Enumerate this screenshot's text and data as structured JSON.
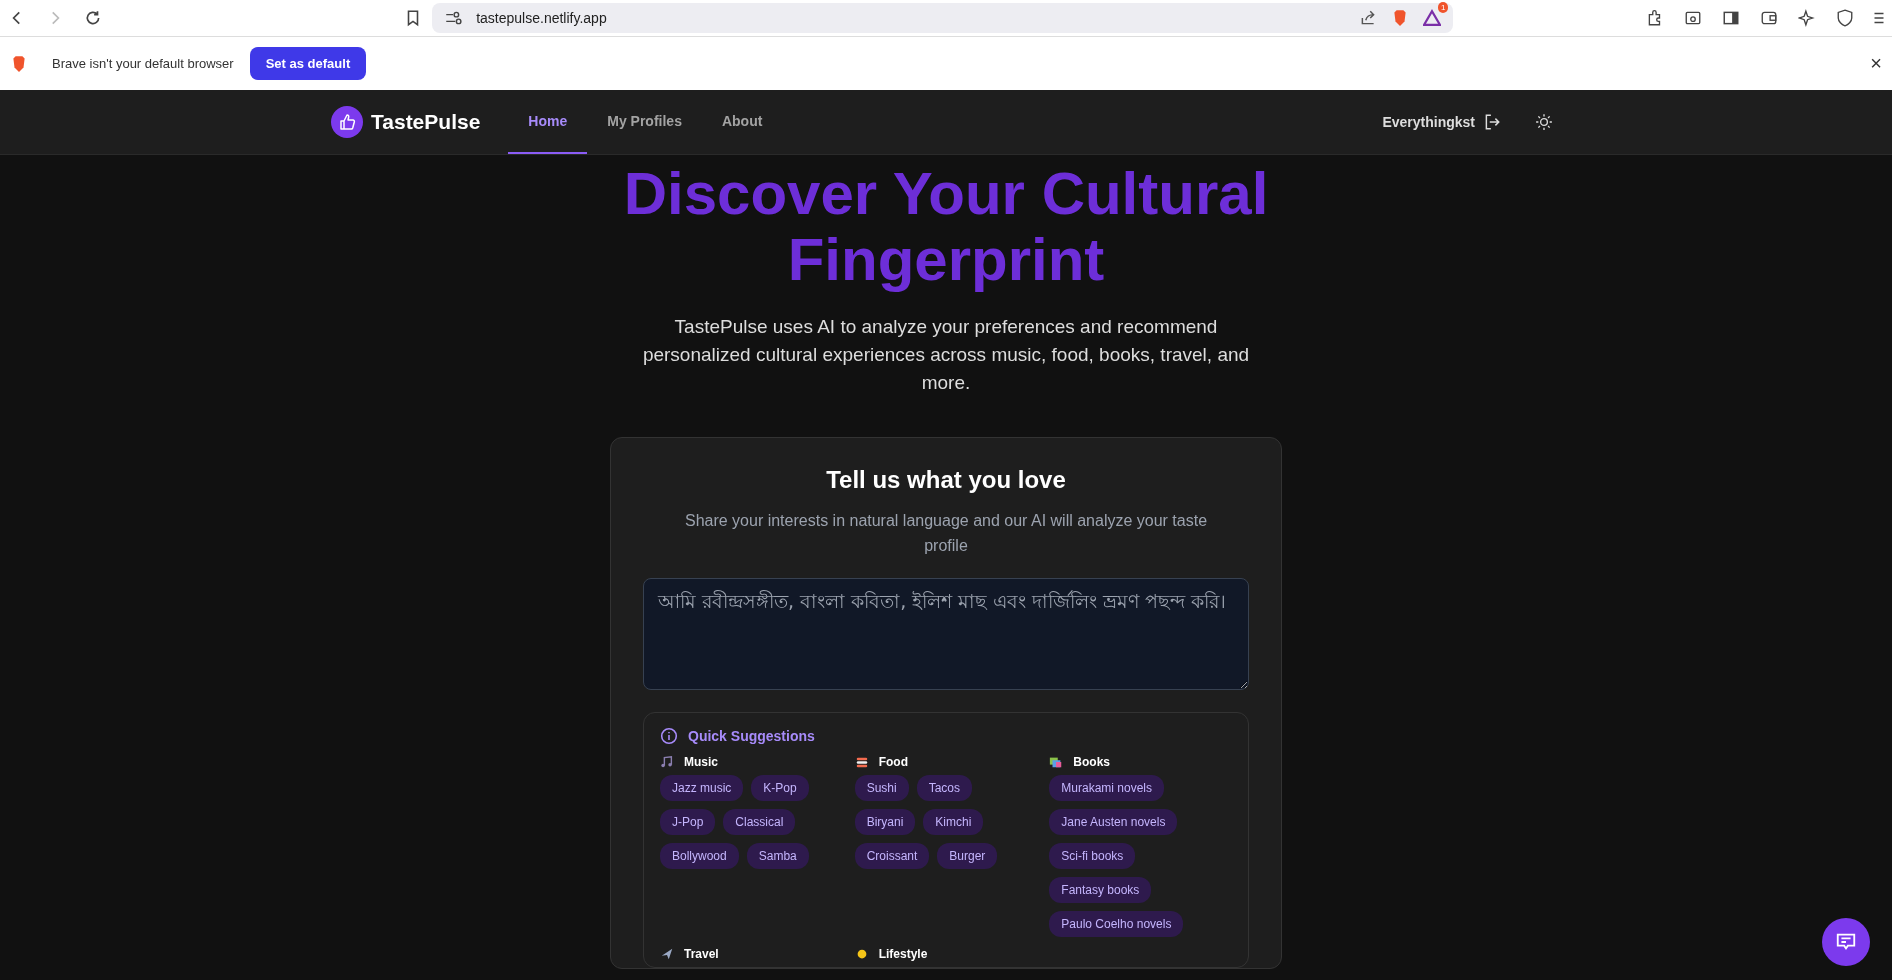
{
  "browser": {
    "url": "tastepulse.netlify.app",
    "rewards_badge": "1"
  },
  "infobar": {
    "message": "Brave isn't your default browser",
    "button": "Set as default",
    "close": "×"
  },
  "nav": {
    "brand": "TastePulse",
    "links": [
      {
        "label": "Home",
        "selected": true
      },
      {
        "label": "My Profiles",
        "selected": false
      },
      {
        "label": "About",
        "selected": false
      }
    ],
    "user": "Everythingkst"
  },
  "hero": {
    "title": "Discover Your Cultural Fingerprint",
    "subtitle": "TastePulse uses AI to analyze your preferences and recommend personalized cultural experiences across music, food, books, travel, and more."
  },
  "card": {
    "title": "Tell us what you love",
    "description": "Share your interests in natural language and our AI will analyze your taste profile",
    "input": {
      "placeholder": "আমি রবীন্দ্রসঙ্গীত, বাংলা কবিতা, ইলিশ মাছ এবং দার্জিলিং ভ্রমণ পছন্দ করি।"
    },
    "suggestions": {
      "title": "Quick Suggestions",
      "categories": [
        {
          "name": "Music",
          "kind": "music",
          "chips": [
            "Jazz music",
            "K-Pop",
            "J-Pop",
            "Classical",
            "Bollywood",
            "Samba"
          ]
        },
        {
          "name": "Food",
          "kind": "food",
          "chips": [
            "Sushi",
            "Tacos",
            "Biryani",
            "Kimchi",
            "Croissant",
            "Burger"
          ]
        },
        {
          "name": "Books",
          "kind": "books",
          "chips": [
            "Murakami novels",
            "Jane Austen novels",
            "Sci-fi books",
            "Fantasy books",
            "Paulo Coelho novels"
          ]
        },
        {
          "name": "Travel",
          "kind": "travel"
        },
        {
          "name": "Lifestyle",
          "kind": "lifestyle"
        }
      ]
    }
  }
}
